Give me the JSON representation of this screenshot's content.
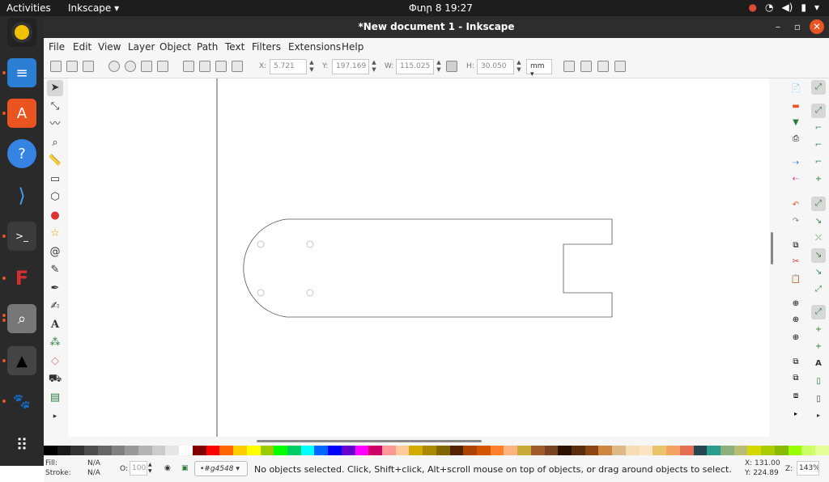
{
  "topbar": {
    "activities": "Activities",
    "app_menu": "Inkscape ▾",
    "clock": "Փտր 8  19:27"
  },
  "dock": {
    "items": [
      {
        "name": "rhythmbox-icon",
        "color": "#f2c200"
      },
      {
        "name": "libreoffice-writer-icon",
        "color": "#2a7fd4"
      },
      {
        "name": "ubuntu-software-icon",
        "color": "#e95420"
      },
      {
        "name": "help-icon",
        "color": "#3584e4"
      },
      {
        "name": "vscode-icon",
        "color": "#1f7ad2"
      },
      {
        "name": "terminal-icon",
        "color": "#3b3b3b"
      },
      {
        "name": "freecad-icon",
        "color": "#d32f2f"
      },
      {
        "name": "magnifier-icon",
        "color": "#888888"
      },
      {
        "name": "inkscape-icon",
        "color": "#111111"
      },
      {
        "name": "gimp-icon",
        "color": "#6b5a3b"
      },
      {
        "name": "app-grid-icon",
        "color": "#2a2a2a"
      }
    ]
  },
  "window": {
    "title": "*New document 1 - Inkscape"
  },
  "menubar": {
    "items": [
      "File",
      "Edit",
      "View",
      "Layer",
      "Object",
      "Path",
      "Text",
      "Filters",
      "Extensions",
      "Help"
    ]
  },
  "toolctl": {
    "x_label": "X:",
    "x_value": "5.721",
    "y_label": "Y:",
    "y_value": "197.169",
    "w_label": "W:",
    "w_value": "115.025",
    "h_label": "H:",
    "h_value": "30.050",
    "unit": "mm ▾"
  },
  "statusbar": {
    "fill_label": "Fill:",
    "fill_value": "N/A",
    "stroke_label": "Stroke:",
    "stroke_value": "N/A",
    "opacity_label": "O:",
    "opacity_value": "100",
    "layer": "•#g4548 ▾",
    "message": "No objects selected. Click, Shift+click, Alt+scroll mouse on top of objects, or drag around objects to select.",
    "x_coord": "X: 131.00",
    "y_coord": "Y: 224.89",
    "zoom_label": "Z:",
    "zoom_value": "143%"
  },
  "palette": [
    "#000000",
    "#1a1a1a",
    "#333333",
    "#4d4d4d",
    "#666666",
    "#808080",
    "#999999",
    "#b3b3b3",
    "#cccccc",
    "#e6e6e6",
    "#ffffff",
    "#800000",
    "#ff0000",
    "#ff6600",
    "#ffcc00",
    "#ffff00",
    "#99cc00",
    "#00ff00",
    "#00cc66",
    "#00ffff",
    "#0066ff",
    "#0000ff",
    "#6600cc",
    "#ff00ff",
    "#cc0066",
    "#ff9999",
    "#ffcc99",
    "#d4aa00",
    "#aa8800",
    "#806600",
    "#552200",
    "#aa4400",
    "#d45500",
    "#ff7f2a",
    "#ffb380",
    "#c8ab37",
    "#a05a2c",
    "#784421",
    "#2b1100",
    "#5a2d0c",
    "#8b4513",
    "#cd853f",
    "#deb887",
    "#f5deb3",
    "#ffe4c4",
    "#e9c46a",
    "#f4a261",
    "#e76f51",
    "#264653",
    "#2a9d8f",
    "#8ab17d",
    "#babb74",
    "#d4d700",
    "#aacc00",
    "#88bb00",
    "#99ff00",
    "#ccff66",
    "#e5ff99"
  ]
}
